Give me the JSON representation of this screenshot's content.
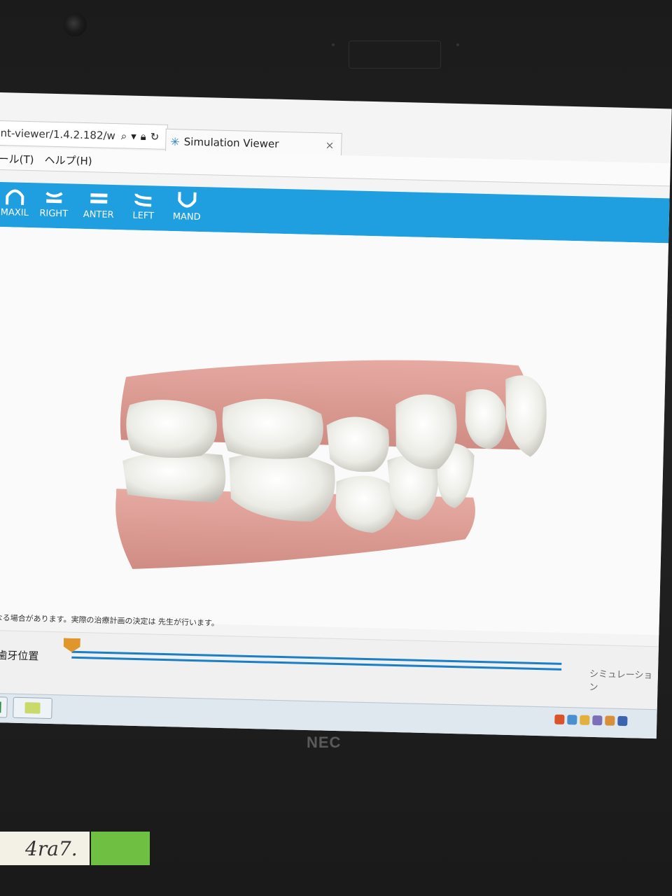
{
  "browser": {
    "url_fragment": "nt-viewer/1.4.2.182/w",
    "tab_title": "Simulation Viewer",
    "tab_close": "×",
    "menu_items": [
      "ール(T)",
      "ヘルプ(H)"
    ]
  },
  "toolbar": {
    "buttons": [
      {
        "label": "MAXIL",
        "icon": "maxillary-arch-icon"
      },
      {
        "label": "RIGHT",
        "icon": "right-view-icon"
      },
      {
        "label": "ANTER",
        "icon": "anterior-view-icon"
      },
      {
        "label": "LEFT",
        "icon": "left-view-icon"
      },
      {
        "label": "MAND",
        "icon": "mandibular-arch-icon"
      }
    ]
  },
  "viewer": {
    "notice": "異なる場合があります。実際の治療計画の決定は 先生が行います。"
  },
  "timeline": {
    "left_label": "の歯牙位置",
    "right_label": "シミュレーション",
    "position": 0
  },
  "laptop": {
    "brand": "NEC",
    "sticker_text": "4ra7."
  },
  "colors": {
    "toolbar_blue": "#1f9ee0",
    "slider_blue": "#1a7fc4",
    "slider_thumb": "#e0962b",
    "gum": "#dc9c95",
    "tooth": "#f0f0ec"
  }
}
